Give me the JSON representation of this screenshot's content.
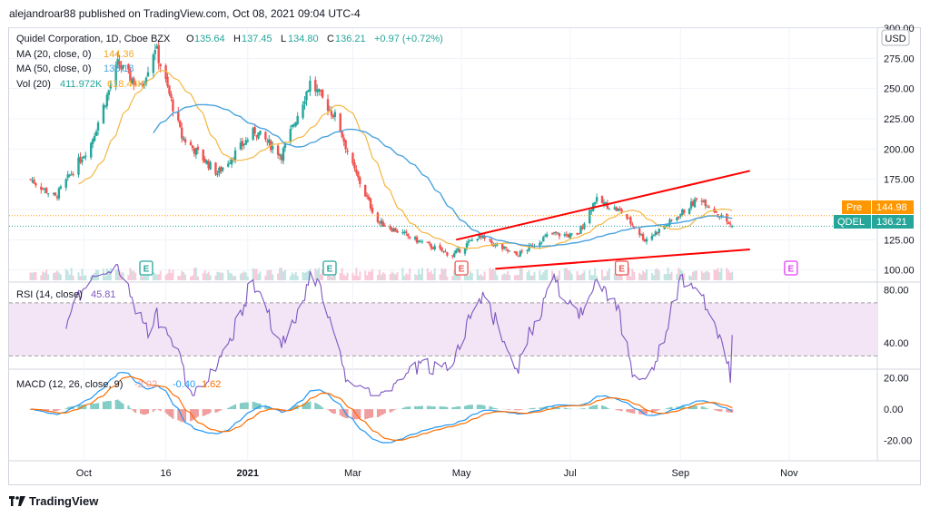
{
  "header": {
    "text": "alejandroar88 published on TradingView.com, Oct 08, 2021 09:04 UTC-4"
  },
  "footer": {
    "brand": "TradingView"
  },
  "legend": {
    "symbol": "Quidel Corporation, 1D, Cboe BZX",
    "o_label": "O",
    "o_value": "135.64",
    "h_label": "H",
    "h_value": "137.45",
    "l_label": "L",
    "l_value": "134.80",
    "c_label": "C",
    "c_value": "136.21",
    "change": "+0.97 (+0.72%)",
    "ma20_label": "MA (20, close, 0)",
    "ma20_value": "144.36",
    "ma50_label": "MA (50, close, 0)",
    "ma50_value": "136.18",
    "vol_label": "Vol (20)",
    "vol_value1": "411.972K",
    "vol_value2": "618.44K",
    "rsi_label": "RSI (14, close)",
    "rsi_value": "45.81",
    "macd_label": "MACD (12, 26, close, 9)",
    "macd_v1": "-2.02",
    "macd_v2": "-0.40",
    "macd_v3": "1.62"
  },
  "currency": "USD",
  "price_tags": {
    "pre_label": "Pre",
    "pre_value": "144.98",
    "sym_label": "QDEL",
    "sym_value": "136.21"
  },
  "colors": {
    "up": "#26a69a",
    "down": "#ef5350",
    "ma20": "#f4b642",
    "ma50": "#4aa3df",
    "trend": "#ff0000",
    "rsi": "#7e57c2",
    "macd": "#2196f3",
    "signal": "#ff6d00",
    "pre": "#ff9800"
  },
  "chart_data": [
    {
      "type": "candlestick",
      "title": "Quidel Corporation, 1D, Cboe BZX",
      "x_ticks": [
        "Oct",
        "16",
        "2021",
        "Mar",
        "May",
        "Jul",
        "Sep",
        "Nov"
      ],
      "y_ticks": [
        "100.00",
        "125.00",
        "150.00",
        "175.00",
        "200.00",
        "225.00",
        "250.00",
        "275.00",
        "300.00"
      ],
      "ylim": [
        90,
        300
      ],
      "anchors": [
        {
          "date": "Sep 01, 2020",
          "close": 175
        },
        {
          "date": "Sep 15, 2020",
          "close": 160
        },
        {
          "date": "Oct 05, 2020",
          "close": 205
        },
        {
          "date": "Oct 20, 2020",
          "close": 270
        },
        {
          "date": "Nov 02, 2020",
          "close": 250
        },
        {
          "date": "Nov 10, 2020",
          "close": 285
        },
        {
          "date": "Nov 25, 2020",
          "close": 210
        },
        {
          "date": "Dec 15, 2020",
          "close": 180
        },
        {
          "date": "Jan 05, 2021",
          "close": 215
        },
        {
          "date": "Jan 20, 2021",
          "close": 195
        },
        {
          "date": "Feb 05, 2021",
          "close": 255
        },
        {
          "date": "Feb 20, 2021",
          "close": 225
        },
        {
          "date": "Mar 01, 2021",
          "close": 185
        },
        {
          "date": "Mar 15, 2021",
          "close": 140
        },
        {
          "date": "Apr 05, 2021",
          "close": 125
        },
        {
          "date": "Apr 26, 2021",
          "close": 112
        },
        {
          "date": "May 10, 2021",
          "close": 128
        },
        {
          "date": "Jun 01, 2021",
          "close": 112
        },
        {
          "date": "Jun 20, 2021",
          "close": 130
        },
        {
          "date": "Jul 05, 2021",
          "close": 128
        },
        {
          "date": "Jul 15, 2021",
          "close": 158
        },
        {
          "date": "Jul 30, 2021",
          "close": 148
        },
        {
          "date": "Aug 12, 2021",
          "close": 125
        },
        {
          "date": "Aug 25, 2021",
          "close": 138
        },
        {
          "date": "Sep 12, 2021",
          "close": 160
        },
        {
          "date": "Sep 30, 2021",
          "close": 136
        }
      ],
      "series": [
        {
          "name": "MA (20, close, 0)",
          "last": 144.36
        },
        {
          "name": "MA (50, close, 0)",
          "last": 136.18
        }
      ],
      "trendlines": [
        {
          "from": [
            "Apr 28, 2021",
            125
          ],
          "to": [
            "Oct 10, 2021",
            182
          ]
        },
        {
          "from": [
            "May 20, 2021",
            101
          ],
          "to": [
            "Oct 10, 2021",
            117
          ]
        }
      ],
      "reference_lines": [
        {
          "label": "Pre",
          "value": 144.98
        },
        {
          "label": "QDEL",
          "value": 136.21
        }
      ],
      "earnings_markers": [
        {
          "label": "E",
          "date": "Aug 05, 2020",
          "kind": "past"
        },
        {
          "label": "E",
          "date": "Nov 05, 2020",
          "kind": "past"
        },
        {
          "label": "E",
          "date": "Feb 16, 2021",
          "kind": "past"
        },
        {
          "label": "E",
          "date": "May 01, 2021",
          "kind": "miss"
        },
        {
          "label": "E",
          "date": "Jul 30, 2021",
          "kind": "miss"
        },
        {
          "label": "E",
          "date": "Nov 02, 2021",
          "kind": "future"
        }
      ]
    },
    {
      "type": "line",
      "title": "RSI (14, close)",
      "y_ticks": [
        "40.00",
        "80.00"
      ],
      "ylim": [
        20,
        85
      ],
      "band": [
        30,
        70
      ],
      "last": 45.81
    },
    {
      "type": "line",
      "title": "MACD (12, 26, close, 9)",
      "y_ticks": [
        "-20.00",
        "0.00",
        "20.00"
      ],
      "ylim": [
        -33,
        25
      ],
      "series": [
        {
          "name": "MACD",
          "last": -0.4
        },
        {
          "name": "Signal",
          "last": 1.62
        }
      ],
      "histogram_last": -2.02
    }
  ]
}
